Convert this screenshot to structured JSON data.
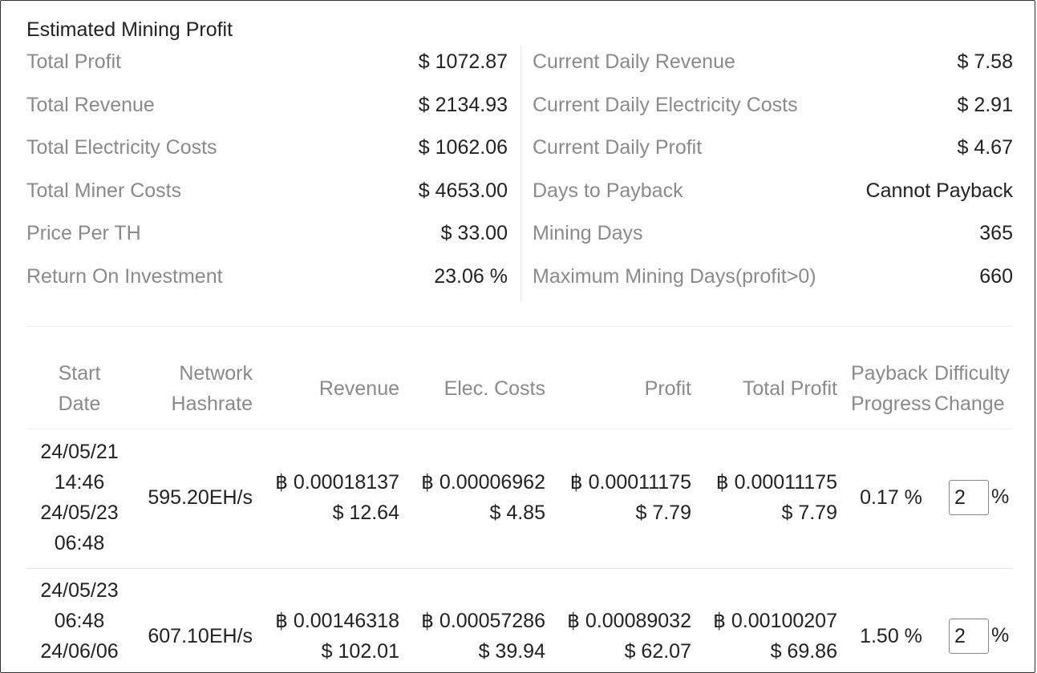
{
  "title": "Estimated Mining Profit",
  "summary_left": [
    {
      "label": "Total Profit",
      "value": "$ 1072.87"
    },
    {
      "label": "Total Revenue",
      "value": "$ 2134.93"
    },
    {
      "label": "Total Electricity Costs",
      "value": "$ 1062.06"
    },
    {
      "label": "Total Miner Costs",
      "value": "$ 4653.00"
    },
    {
      "label": "Price Per TH",
      "value": "$ 33.00"
    },
    {
      "label": "Return On Investment",
      "value": "23.06 %"
    }
  ],
  "summary_right": [
    {
      "label": "Current Daily Revenue",
      "value": "$ 7.58"
    },
    {
      "label": "Current Daily Electricity Costs",
      "value": "$ 2.91"
    },
    {
      "label": "Current Daily Profit",
      "value": "$ 4.67"
    },
    {
      "label": "Days to Payback",
      "value": "Cannot Payback"
    },
    {
      "label": "Mining Days",
      "value": "365"
    },
    {
      "label": "Maximum Mining Days(profit>0)",
      "value": "660"
    }
  ],
  "table": {
    "headers": {
      "start_date": [
        "Start",
        "Date"
      ],
      "hashrate": [
        "Network",
        "Hashrate"
      ],
      "revenue": "Revenue",
      "elec": "Elec. Costs",
      "profit": "Profit",
      "total_profit": "Total Profit",
      "payback": [
        "Payback",
        "Progress"
      ],
      "difficulty": [
        "Difficulty",
        "Change"
      ]
    },
    "rows": [
      {
        "date_lines": [
          "24/05/21",
          "14:46",
          "24/05/23",
          "06:48"
        ],
        "hashrate": "595.20EH/s",
        "revenue": [
          "฿ 0.00018137",
          "$ 12.64"
        ],
        "elec": [
          "฿ 0.00006962",
          "$ 4.85"
        ],
        "profit": [
          "฿ 0.00011175",
          "$ 7.79"
        ],
        "total_profit": [
          "฿ 0.00011175",
          "$ 7.79"
        ],
        "payback": "0.17 %",
        "difficulty_value": "2",
        "pct": "%"
      },
      {
        "date_lines": [
          "24/05/23",
          "06:48",
          "24/06/06"
        ],
        "hashrate": "607.10EH/s",
        "revenue": [
          "฿ 0.00146318",
          "$ 102.01"
        ],
        "elec": [
          "฿ 0.00057286",
          "$ 39.94"
        ],
        "profit": [
          "฿ 0.00089032",
          "$ 62.07"
        ],
        "total_profit": [
          "฿ 0.00100207",
          "$ 69.86"
        ],
        "payback": "1.50 %",
        "difficulty_value": "2",
        "pct": "%"
      }
    ]
  }
}
